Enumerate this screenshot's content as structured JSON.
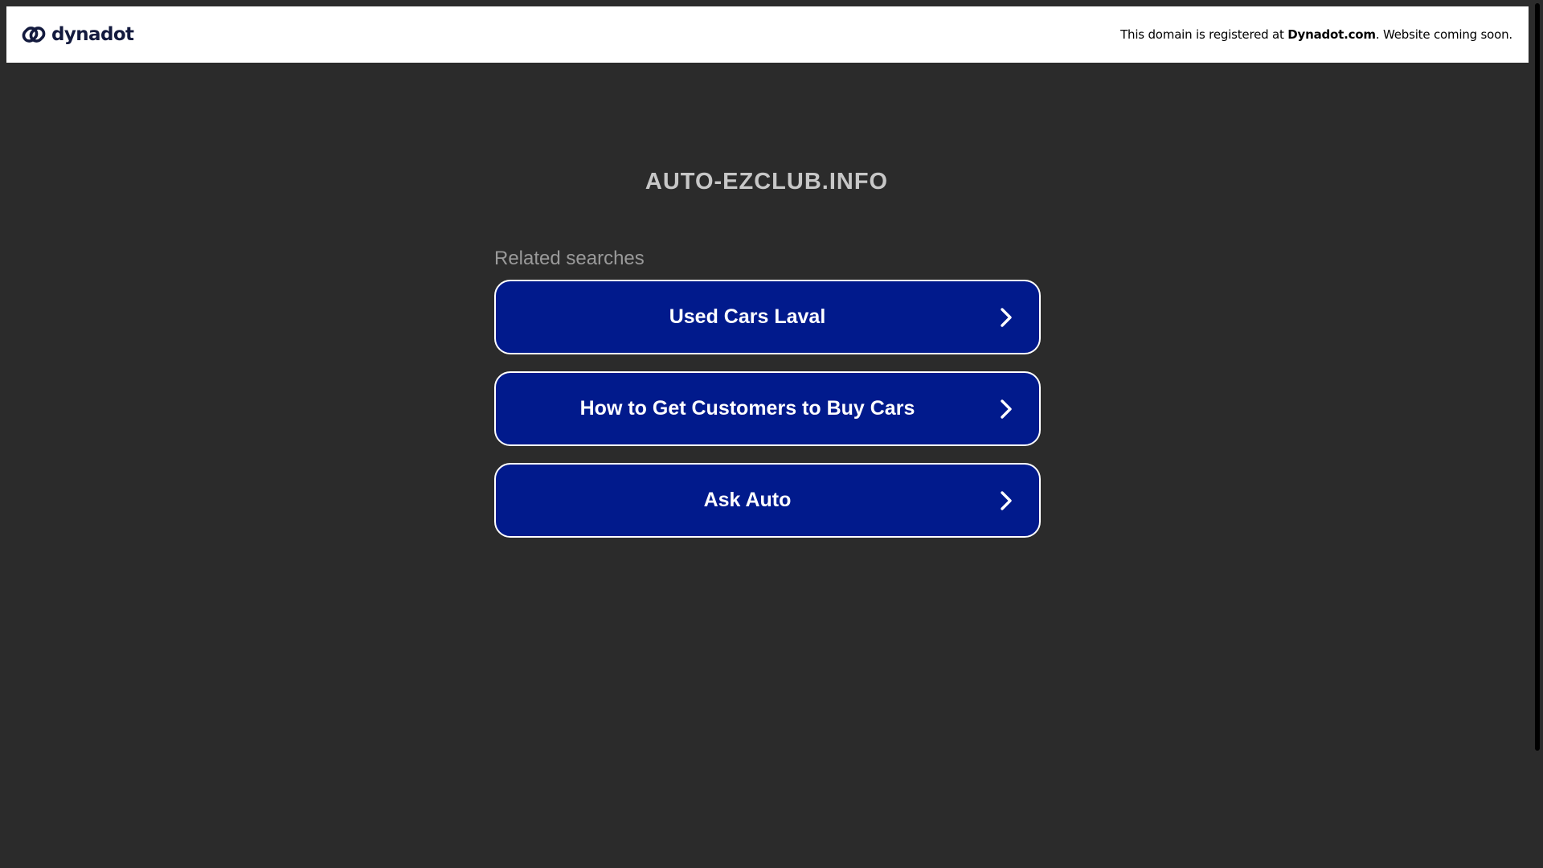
{
  "banner": {
    "logo_text": "dynadot",
    "notice_prefix": "This domain is registered at ",
    "notice_brand": "Dynadot.com",
    "notice_suffix": ". Website coming soon."
  },
  "main": {
    "domain": "AUTO-EZCLUB.INFO",
    "related_heading": "Related searches",
    "searches": [
      {
        "label": "Used Cars Laval",
        "icon": "chevron-right-icon"
      },
      {
        "label": "How to Get Customers to Buy Cars",
        "icon": "chevron-right-icon"
      },
      {
        "label": "Ask Auto",
        "icon": "chevron-right-icon"
      }
    ]
  },
  "colors": {
    "page_background": "#2b2b2b",
    "banner_background": "#ffffff",
    "button_background": "#011a8c",
    "button_border": "#ffffff",
    "title_text": "#c7c7c7",
    "heading_text": "#9a9a9a",
    "logo_text": "#131a3e"
  }
}
